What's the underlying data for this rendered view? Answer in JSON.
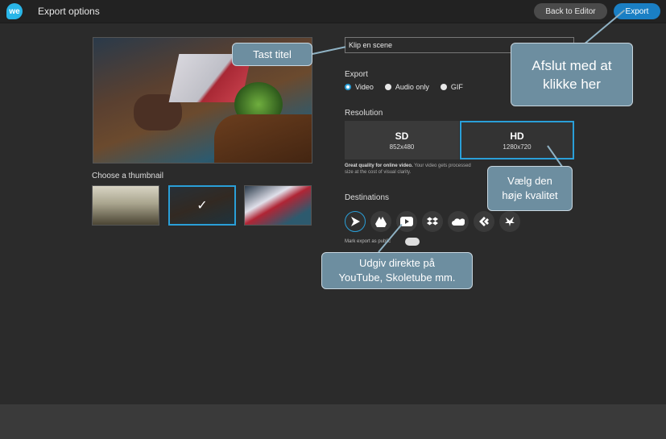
{
  "header": {
    "logo_text": "we",
    "title": "Export options",
    "back_label": "Back to Editor",
    "export_label": "Export"
  },
  "thumbnails": {
    "label": "Choose a thumbnail",
    "selected_mark": "✓"
  },
  "title_field": {
    "value": "Klip en scene"
  },
  "export_section": {
    "label": "Export",
    "options": [
      "Video",
      "Audio only",
      "GIF"
    ],
    "selected": "Video"
  },
  "resolution": {
    "label": "Resolution",
    "sd_name": "SD",
    "sd_size": "852x480",
    "hd_name": "HD",
    "hd_size": "1280x720",
    "desc_bold": "Great quality for online video.",
    "desc_text": "Your video gets processed",
    "desc_text2": "size at the cost of visual clarity."
  },
  "destinations": {
    "label": "Destinations",
    "items": [
      "play-icon",
      "drive-icon",
      "youtube-icon",
      "dropbox-icon",
      "onedrive-icon",
      "cast-icon",
      "bird-icon"
    ],
    "mark_public": "Mark export as public"
  },
  "callouts": {
    "title": "Tast titel",
    "export_line1": "Afslut med at",
    "export_line2": "klikke her",
    "hd_line1": "Vælg den",
    "hd_line2": "høje kvalitet",
    "dest_line1": "Udgiv direkte på",
    "dest_line2": "YouTube, Skoletube mm."
  },
  "colors": {
    "accent": "#2a9fd8",
    "export_button": "#1a7fc4",
    "callout": "#6d8ea0"
  }
}
